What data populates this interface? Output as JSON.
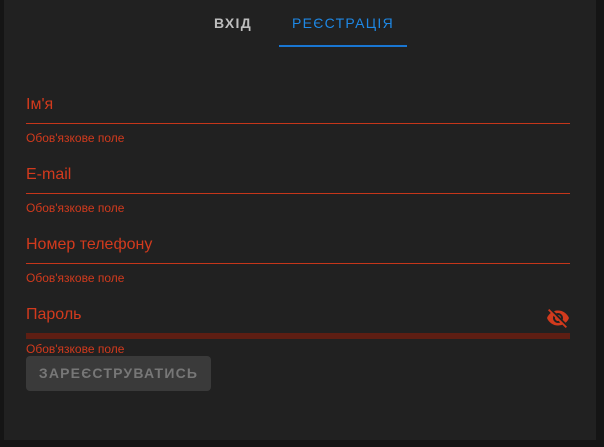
{
  "tabs": {
    "login_label": "ВХІД",
    "register_label": "РЕЄСТРАЦІЯ",
    "active": "register"
  },
  "form": {
    "name": {
      "label": "Ім'я",
      "value": "",
      "error": "Обов'язкове поле"
    },
    "email": {
      "label": "E-mail",
      "value": "",
      "error": "Обов'язкове поле"
    },
    "phone": {
      "label": "Номер телефону",
      "value": "",
      "error": "Обов'язкове поле"
    },
    "password": {
      "label": "Пароль",
      "value": "",
      "error": "Обов'язкове поле",
      "toggle_icon": "eye-off-icon"
    },
    "submit_label": "ЗАРЕЄСТРУВАТИСЬ"
  },
  "colors": {
    "background": "#212121",
    "accent": "#1e88e5",
    "error": "#d23a1d",
    "disabled_button": "#3a3a3a"
  }
}
